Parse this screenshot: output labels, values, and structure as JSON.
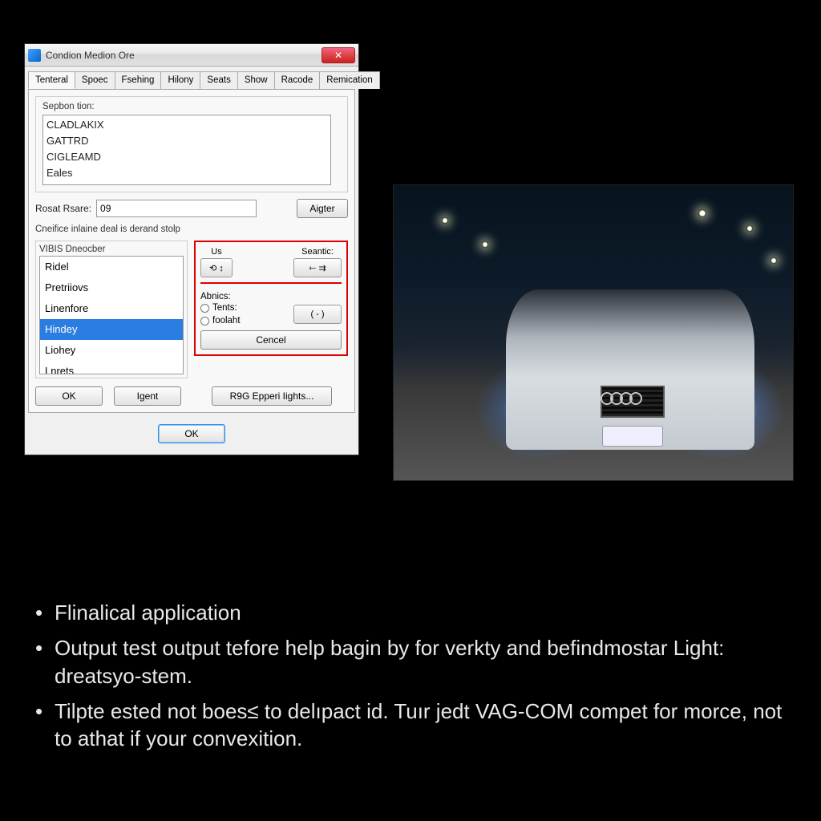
{
  "window": {
    "title": "Condion Medion Ore"
  },
  "tabs": {
    "items": [
      "Tenteral",
      "Spoec",
      "Fsehing",
      "Hilony",
      "Seats",
      "Show",
      "Racode",
      "Remication"
    ],
    "activeIndex": 0
  },
  "topSection": {
    "label": "Sepbon tion:",
    "items": [
      "CLADLAKIX",
      "GATTRD",
      "CIGLEAMD",
      "Eales"
    ]
  },
  "resetRow": {
    "label": "Rosat Rsare:",
    "value": "09",
    "button": "Aigter"
  },
  "info": "Cneifice inlaine deal is derand stolp",
  "leftList": {
    "label": "VIBIS Dneocber",
    "items": [
      "Ridel",
      "Pretriiovs",
      "Linenfore",
      "Hindey",
      "Liohey",
      "Lnrets"
    ],
    "selectedIndex": 3
  },
  "rightBlock": {
    "usLabel": "Us",
    "searchLabel": "Seantic:",
    "usButton": "⟲ ↕",
    "searchButton": "⇽ ⇉",
    "redHighlighted": true,
    "abnicsLabel": "Abnics:",
    "radio1": "Tents:",
    "radio2": "foolaht",
    "abnicsButton": "( - )",
    "cancel": "Cencel"
  },
  "bottomRow": {
    "ok": "OK",
    "igent": "Igent",
    "rsg": "R9G Epperi Iights..."
  },
  "okRow": "OK",
  "bullets": [
    "Flinalical application",
    "Output test output tefore help bagin by for verkty and befindmostar Light: dreatsyo-stem.",
    "Tilpte ested not boes≤ to delıpact id. Tuır jedt VAG-COM compet for morce, not to athat if your convexition."
  ],
  "icons": {
    "close": "✕"
  }
}
